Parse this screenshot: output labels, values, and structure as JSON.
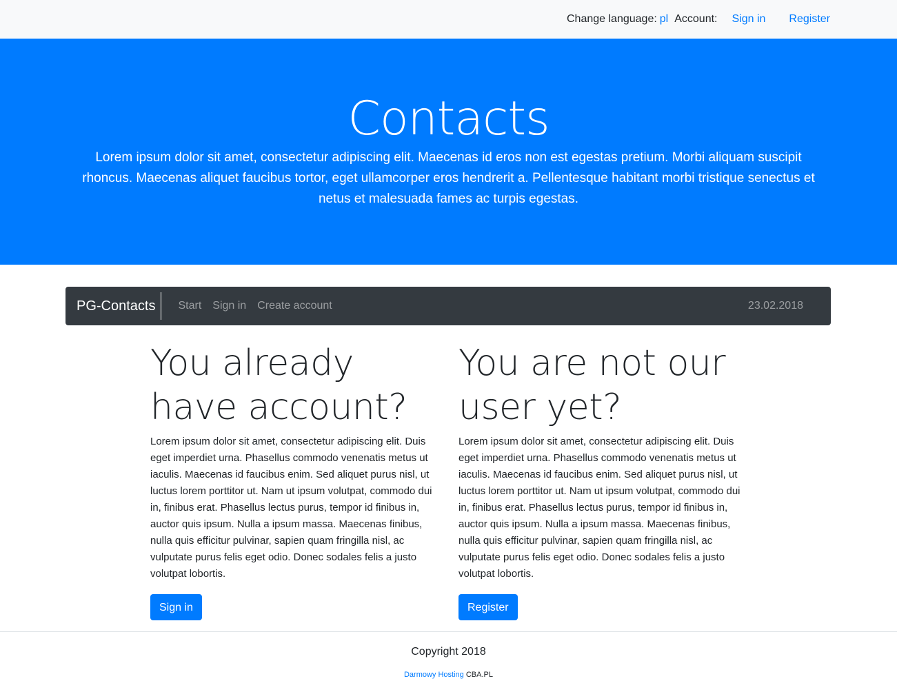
{
  "topbar": {
    "change_language_label": "Change language:",
    "language_link": "pl",
    "account_label": "Account:",
    "sign_in_link": "Sign in",
    "register_link": "Register"
  },
  "hero": {
    "title": "Contacts",
    "lead": "Lorem ipsum dolor sit amet, consectetur adipiscing elit. Maecenas id eros non est egestas pretium. Morbi aliquam suscipit rhoncus. Maecenas aliquet faucibus tortor, eget ullamcorper eros hendrerit a. Pellentesque habitant morbi tristique senectus et netus et malesuada fames ac turpis egestas."
  },
  "navbar": {
    "brand": "PG-Contacts",
    "items": [
      {
        "label": "Start"
      },
      {
        "label": "Sign in"
      },
      {
        "label": "Create account"
      }
    ],
    "date": "23.02.2018"
  },
  "columns": [
    {
      "heading": "You already have account?",
      "text": "Lorem ipsum dolor sit amet, consectetur adipiscing elit. Duis eget imperdiet urna. Phasellus commodo venenatis metus ut iaculis. Maecenas id faucibus enim. Sed aliquet purus nisl, ut luctus lorem porttitor ut. Nam ut ipsum volutpat, commodo dui in, finibus erat. Phasellus lectus purus, tempor id finibus in, auctor quis ipsum. Nulla a ipsum massa. Maecenas finibus, nulla quis efficitur pulvinar, sapien quam fringilla nisl, ac vulputate purus felis eget odio. Donec sodales felis a justo volutpat lobortis.",
      "button": "Sign in"
    },
    {
      "heading": "You are not our user yet?",
      "text": "Lorem ipsum dolor sit amet, consectetur adipiscing elit. Duis eget imperdiet urna. Phasellus commodo venenatis metus ut iaculis. Maecenas id faucibus enim. Sed aliquet purus nisl, ut luctus lorem porttitor ut. Nam ut ipsum volutpat, commodo dui in, finibus erat. Phasellus lectus purus, tempor id finibus in, auctor quis ipsum. Nulla a ipsum massa. Maecenas finibus, nulla quis efficitur pulvinar, sapien quam fringilla nisl, ac vulputate purus felis eget odio. Donec sodales felis a justo volutpat lobortis.",
      "button": "Register"
    }
  ],
  "footer": {
    "copyright": "Copyright 2018",
    "hosting_link": "Darmowy Hosting",
    "hosting_text": "CBA.PL"
  },
  "colors": {
    "primary": "#007bff",
    "navbar_bg": "#343a40",
    "topbar_bg": "#f8f9fa"
  }
}
